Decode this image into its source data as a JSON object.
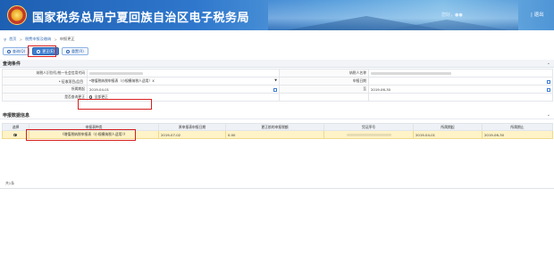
{
  "header": {
    "title": "国家税务总局宁夏回族自治区电子税务局",
    "user": "您好，●●",
    "exit": "| 退出"
  },
  "breadcrumb": {
    "home": "首页",
    "parent": "税费申报及缴纳",
    "current": "申报更正"
  },
  "toolbar": {
    "query_label": "查询(Q)",
    "correct_label": "更正(E)",
    "reset_label": "重置(R)"
  },
  "query_section": {
    "title": "查询条件",
    "fields": {
      "taxpayer_id_label": "纳税人识别号/统一社会信用代码",
      "taxpayer_name_label": "纳税人名称",
      "levy_label": "* 征收项目/品目",
      "levy_value": "*增值税纳税申报表（小规模纳税人适用）X",
      "report_date_label": "申报日期",
      "period_start_label": "所属期起",
      "period_start_value": "2019-04-01",
      "period_end_label": "至",
      "period_end_value": "2019-06-30",
      "correct_flag_label": "是否查询更正",
      "correct_flag_option": "全部更正"
    }
  },
  "result_section": {
    "title": "申报数据信息",
    "columns": [
      "选择",
      "申报表种类",
      "原申报表申报日期",
      "更正前的申报税额",
      "凭证序号",
      "所属期起",
      "所属期止"
    ],
    "rows": [
      {
        "form": "《增值税纳税申报表（小规模纳税人适用）》",
        "orig_date": "2019-07-02",
        "amount": "0.00",
        "start": "2019-04-01",
        "end": "2019-06-30"
      }
    ],
    "total": "共1条"
  },
  "colors": {
    "header_blue": "#1d5fb2",
    "highlight_red": "#d81e1e",
    "selected_row": "#fff3c7"
  }
}
